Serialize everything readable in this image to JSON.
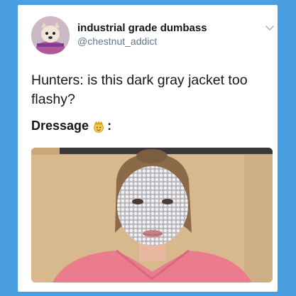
{
  "tweet": {
    "user": {
      "display_name": "industrial grade dumbass",
      "handle": "@chestnut_addict"
    },
    "text": "Hunters: is this dark gray jacket too flashy?",
    "caption": {
      "label": "Dressage",
      "suffix": ":",
      "emoji": "crown-face-emoji"
    },
    "more_icon": "chevron-down-icon"
  },
  "colors": {
    "background": "#4a9fe3",
    "card": "#ffffff",
    "name": "#14171a",
    "handle": "#657786"
  }
}
